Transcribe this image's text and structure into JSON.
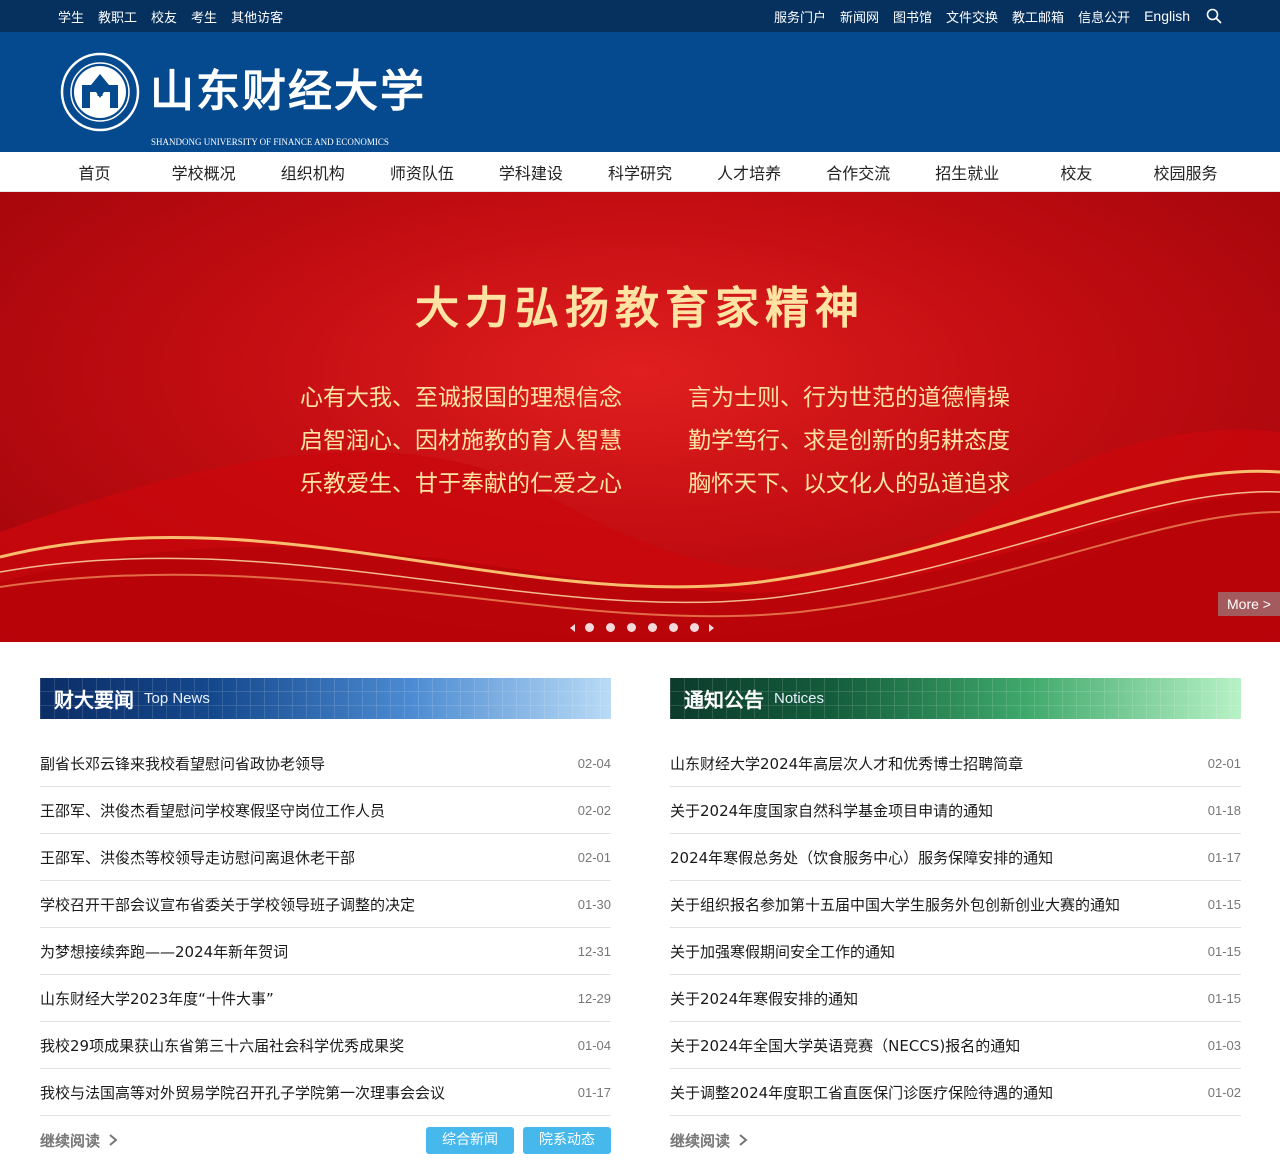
{
  "topbar": {
    "left_links": [
      "学生",
      "教职工",
      "校友",
      "考生",
      "其他访客"
    ],
    "right_links": [
      "服务门户",
      "新闻网",
      "图书馆",
      "文件交换",
      "教工邮箱",
      "信息公开"
    ],
    "english_label": "English",
    "search_icon": "search-icon"
  },
  "header": {
    "university_name_cn": "山东财经大学",
    "university_name_en": "SHANDONG UNIVERSITY OF FINANCE AND ECONOMICS",
    "seal_text": "SHANDONG UNIVERSITY OF FINANCE AND ECONOMICS",
    "brand_color": "#05498f"
  },
  "nav": {
    "items": [
      "首页",
      "学校概况",
      "组织机构",
      "师资队伍",
      "学科建设",
      "科学研究",
      "人才培养",
      "合作交流",
      "招生就业",
      "校友",
      "校园服务"
    ]
  },
  "banner": {
    "title": "大力弘扬教育家精神",
    "lines": [
      [
        "心有大我、至诚报国的理想信念",
        "言为士则、行为世范的道德情操"
      ],
      [
        "启智润心、因材施教的育人智慧",
        "勤学笃行、求是创新的躬耕态度"
      ],
      [
        "乐教爱生、甘于奉献的仁爱之心",
        "胸怀天下、以文化人的弘道追求"
      ]
    ],
    "more_label": "More >",
    "slide_count": 6
  },
  "news": {
    "title_cn": "财大要闻",
    "title_en": "Top News",
    "items": [
      {
        "title": "副省长邓云锋来我校看望慰问省政协老领导",
        "date": "02-04"
      },
      {
        "title": "王邵军、洪俊杰看望慰问学校寒假坚守岗位工作人员",
        "date": "02-02"
      },
      {
        "title": "王邵军、洪俊杰等校领导走访慰问离退休老干部",
        "date": "02-01"
      },
      {
        "title": "学校召开干部会议宣布省委关于学校领导班子调整的决定",
        "date": "01-30"
      },
      {
        "title": "为梦想接续奔跑——2024年新年贺词",
        "date": "12-31"
      },
      {
        "title": "山东财经大学2023年度“十件大事”",
        "date": "12-29"
      },
      {
        "title": "我校29项成果获山东省第三十六届社会科学优秀成果奖",
        "date": "01-04"
      },
      {
        "title": "我校与法国高等对外贸易学院召开孔子学院第一次理事会会议",
        "date": "01-17"
      }
    ],
    "read_more": "继续阅读",
    "tags": [
      "综合新闻",
      "院系动态"
    ]
  },
  "notices": {
    "title_cn": "通知公告",
    "title_en": "Notices",
    "items": [
      {
        "title": "山东财经大学2024年高层次人才和优秀博士招聘简章",
        "date": "02-01"
      },
      {
        "title": "关于2024年度国家自然科学基金项目申请的通知",
        "date": "01-18"
      },
      {
        "title": "2024年寒假总务处（饮食服务中心）服务保障安排的通知",
        "date": "01-17"
      },
      {
        "title": "关于组织报名参加第十五届中国大学生服务外包创新创业大赛的通知",
        "date": "01-15"
      },
      {
        "title": "关于加强寒假期间安全工作的通知",
        "date": "01-15"
      },
      {
        "title": "关于2024年寒假安排的通知",
        "date": "01-15"
      },
      {
        "title": "关于2024年全国大学英语竞赛（NECCS)报名的通知",
        "date": "01-03"
      },
      {
        "title": "关于调整2024年度职工省直医保门诊医疗保险待遇的通知",
        "date": "01-02"
      }
    ],
    "read_more": "继续阅读"
  }
}
